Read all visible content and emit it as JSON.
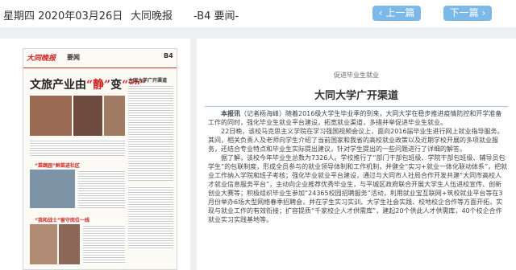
{
  "header": {
    "date": "星期四 2020年03月26日",
    "paper": "大同晚报",
    "page": "-B4 要闻-",
    "prev_label": "上一篇",
    "next_label": "下一篇"
  },
  "thumbnail": {
    "logo": "大同晚报",
    "section": "要闻",
    "page_no": "B4",
    "headline_pre": "文旅产业由",
    "headline_em1": "“静”",
    "headline_mid": "变",
    "headline_em2": "“动”",
    "right_title": "大同大学广开渠道",
    "sub1": "“菜蔬园”鲜菜进社区",
    "sub2": "“我和战士”留守岗位一线"
  },
  "article": {
    "kicker": "促进毕业生就业",
    "title": "大同大学广开渠道",
    "byline": "本报讯",
    "paragraphs": [
      "（记者杨海峰）随着2016级大学生毕业季的到来，大同大学在稳步推进疫情防控和开学准备工作的同时，强化毕业生就业平台建设，拓宽就业渠道，多措并举促进毕业生就业。",
      "22日晚，该校马克思主义学院在学习强国视频会议上，面向2016届毕业生进行网上就业指导服务。其间，相关负责人及老师向学生介绍了当前国家和我省的高校就业政策以及近期学校开展的多项就业服务，还结合专业特点和毕业生实际提出建议，针对学生提出的一些问题进行了详细的解答。",
      "据了解，该校今年毕业生总数为7326人。学校推行了“部门干部包班级、学院干部包班级、辅导员包学生”的包联制度，形成全员参与的就业领导体制和工作机制，并健全“实习+就业一体化联动体系”，把就业工作纳入学院和班子考核；强化毕业就业平台建设，通过与大同市人社局合作开发共建“大同市高校人才就业信息服务平台”，主动向企业推荐优秀毕业生，与平城区政府联合开展大学生人伍进校宣传、创新创业大赛等；积极组织毕业生参加“24365校园招聘服务”活动，利用就业宝互联网+筑校就业平台等在3月份举办6场大型网络春季招聘会，并在学生实习实训、大学生社会实践、校地校企合作等方面开拓，实现与就业工作的有效衔接；扩容提质“千家校企人才供需库”，建起20个供此人才供需库，40个校企合作就业实习实践基地等。"
    ]
  },
  "colors": {
    "accent": "#7cb8e8",
    "headline_red": "#cc2222"
  }
}
